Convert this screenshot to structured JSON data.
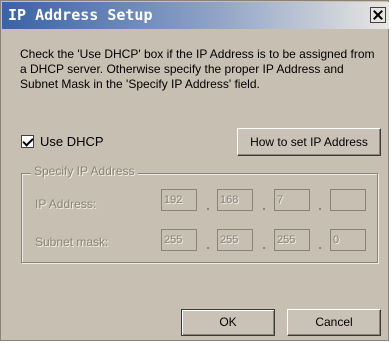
{
  "window": {
    "title": "IP Address Setup"
  },
  "description": "Check the 'Use DHCP' box if the IP Address is to be assigned from a DHCP server.  Otherwise specify the proper IP Address and Subnet Mask in the 'Specify IP Address' field.",
  "dhcp": {
    "label": "Use DHCP",
    "checked": true
  },
  "buttons": {
    "howto": "How to set IP Address",
    "ok": "OK",
    "cancel": "Cancel"
  },
  "group": {
    "label": "Specify IP Address",
    "ip_label": "IP Address:",
    "ip": [
      "192",
      "168",
      "7",
      ""
    ],
    "mask_label": "Subnet mask:",
    "mask": [
      "255",
      "255",
      "255",
      "0"
    ]
  }
}
